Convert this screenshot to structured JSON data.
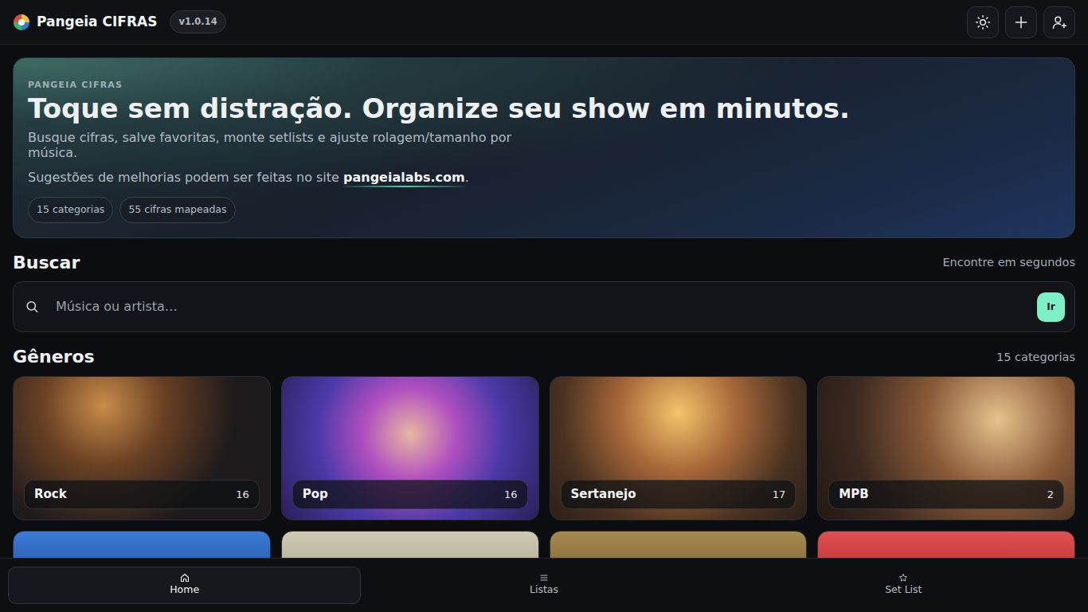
{
  "app": {
    "name": "Pangeia CIFRAS",
    "version": "v1.0.14"
  },
  "hero": {
    "eyebrow": "PANGEIA CIFRAS",
    "title": "Toque sem distração. Organize seu show em minutos.",
    "subtitle": "Busque cifras, salve favoritas, monte setlists e ajuste rolagem/tamanho por música.",
    "suggestion_prefix": "Sugestões de melhorias podem ser feitas no site ",
    "suggestion_link": "pangeialabs.com",
    "suggestion_suffix": ".",
    "chips": [
      "15 categorias",
      "55 cifras mapeadas"
    ]
  },
  "search": {
    "title": "Buscar",
    "hint": "Encontre em segundos",
    "placeholder": "Música ou artista…",
    "button": "Ir"
  },
  "genres": {
    "title": "Gêneros",
    "count": "15 categorias",
    "items": [
      {
        "name": "Rock",
        "count": "16"
      },
      {
        "name": "Pop",
        "count": "16"
      },
      {
        "name": "Sertanejo",
        "count": "17"
      },
      {
        "name": "MPB",
        "count": "2"
      }
    ]
  },
  "bottom_nav": [
    {
      "label": "Home",
      "selected": true
    },
    {
      "label": "Listas",
      "selected": false
    },
    {
      "label": "Set List",
      "selected": false
    }
  ]
}
